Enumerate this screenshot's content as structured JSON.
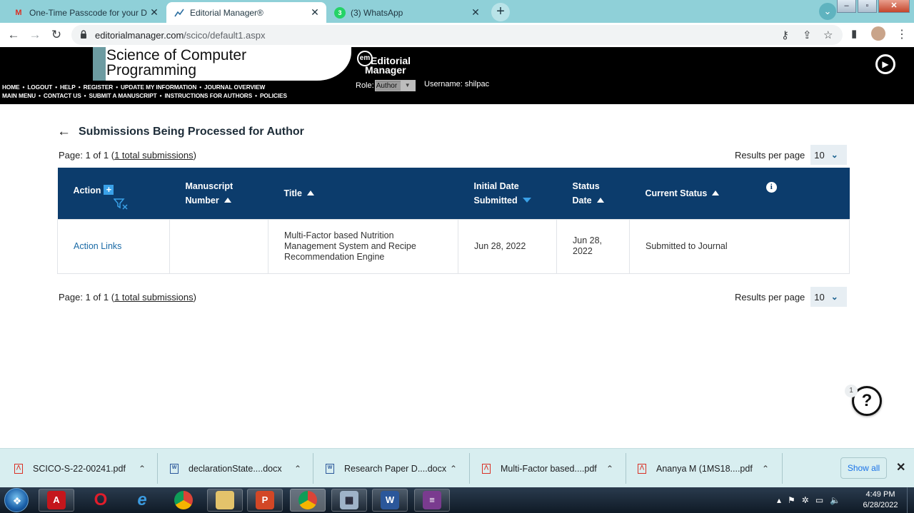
{
  "browser": {
    "tabs": [
      {
        "title": "One-Time Passcode for your Dec",
        "icon": "gmail-icon",
        "active": false
      },
      {
        "title": "Editorial Manager®",
        "icon": "editorial-manager-icon",
        "active": true
      },
      {
        "title": "(3) WhatsApp",
        "icon": "whatsapp-icon",
        "active": false
      }
    ],
    "url_domain": "editorialmanager.com",
    "url_path": "/scico/default1.aspx"
  },
  "header": {
    "journal_title_line1": "Science of Computer",
    "journal_title_line2": "Programming",
    "logo_line1": "Editorial",
    "logo_line2": "Manager",
    "logo_badge": "em",
    "nav_row1": [
      "HOME",
      "LOGOUT",
      "HELP",
      "REGISTER",
      "UPDATE MY INFORMATION",
      "JOURNAL OVERVIEW"
    ],
    "nav_row2": [
      "MAIN MENU",
      "CONTACT US",
      "SUBMIT A MANUSCRIPT",
      "INSTRUCTIONS FOR AUTHORS",
      "POLICIES"
    ],
    "role_label": "Role:",
    "role_value": "Author",
    "username_text": "Username: shilpac"
  },
  "main": {
    "heading": "Submissions Being Processed for Author",
    "page_prefix": "Page: 1 of 1 (",
    "page_link": "1 total submissions",
    "page_suffix": ")",
    "results_label": "Results per page",
    "results_value": "10",
    "columns": {
      "action": "Action",
      "manuscript_line1": "Manuscript",
      "manuscript_line2": "Number",
      "title": "Title",
      "initial_line1": "Initial Date",
      "initial_line2": "Submitted",
      "status_date_line1": "Status",
      "status_date_line2": "Date",
      "current_status": "Current Status"
    },
    "rows": [
      {
        "action": "Action Links",
        "manuscript_number": "",
        "title": "Multi-Factor based Nutrition Management System and Recipe Recommendation Engine",
        "initial_date": "Jun 28, 2022",
        "status_date": "Jun 28, 2022",
        "current_status": "Submitted to Journal"
      }
    ],
    "help_badge": "1",
    "help_symbol": "?"
  },
  "downloads": {
    "items": [
      {
        "name": "SCICO-S-22-00241.pdf",
        "type": "pdf"
      },
      {
        "name": "declarationState....docx",
        "type": "doc"
      },
      {
        "name": "Research Paper D....docx",
        "type": "doc"
      },
      {
        "name": "Multi-Factor based....pdf",
        "type": "pdf"
      },
      {
        "name": "Ananya M (1MS18....pdf",
        "type": "pdf"
      }
    ],
    "show_all": "Show all"
  },
  "taskbar": {
    "time": "4:49 PM",
    "date": "6/28/2022"
  },
  "colors": {
    "table_header": "#0c3c6c",
    "link": "#1a6aa6",
    "accent_blue": "#3aa1e8",
    "tabbar": "#8fd0d8"
  }
}
